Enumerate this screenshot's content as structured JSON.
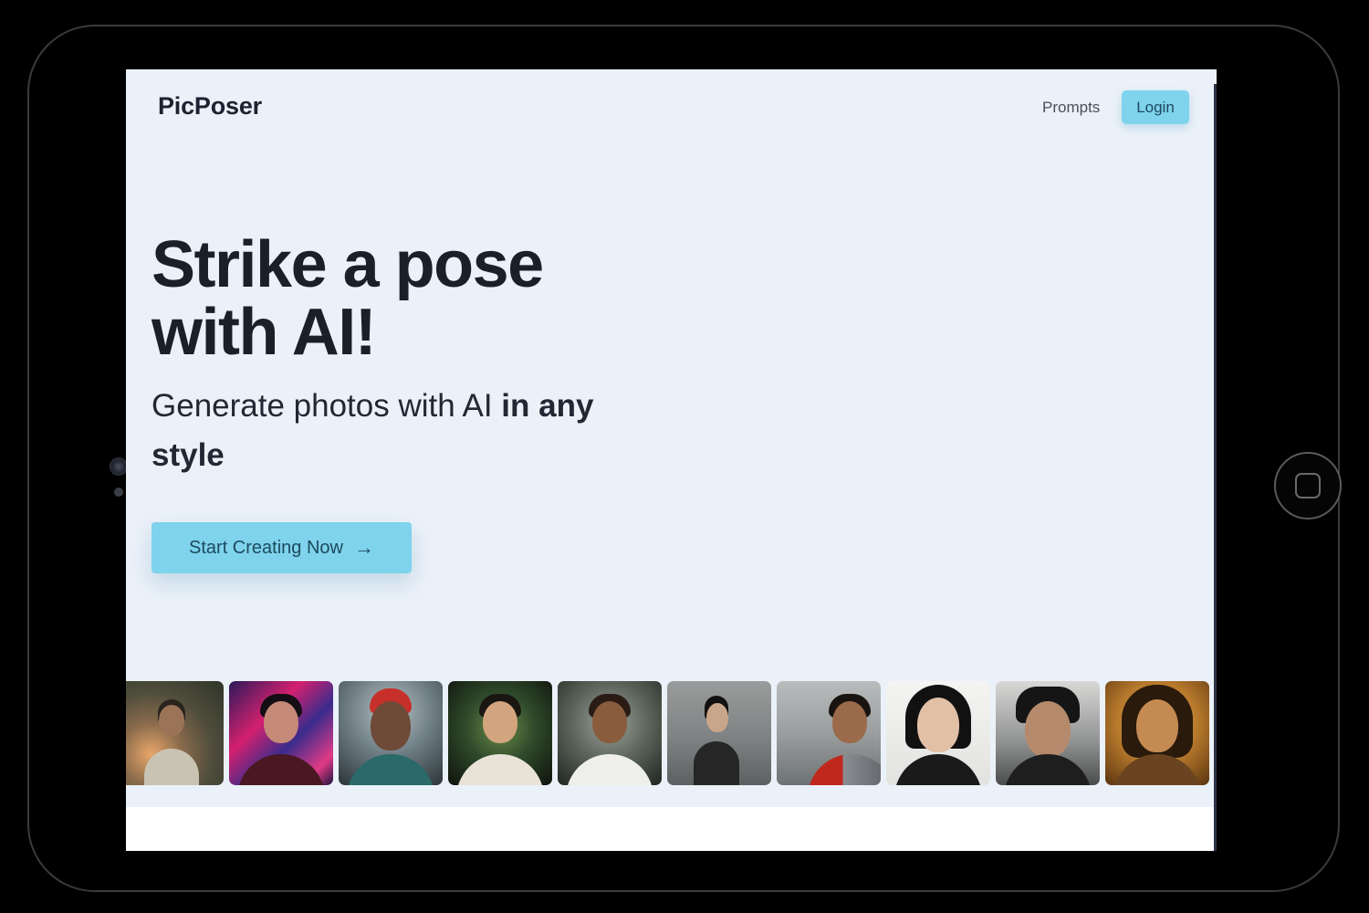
{
  "header": {
    "brand": "PicPoser",
    "nav_prompts": "Prompts",
    "login_label": "Login"
  },
  "hero": {
    "headline": "Strike a pose with AI!",
    "subhead_plain": "Generate photos with AI ",
    "subhead_bold": "in any style",
    "cta_label": "Start Creating Now",
    "cta_icon": "arrow-right-icon"
  },
  "gallery": {
    "items": [
      {
        "name": "portrait-forest-man"
      },
      {
        "name": "portrait-neon-woman"
      },
      {
        "name": "portrait-red-hair-man"
      },
      {
        "name": "portrait-astronaut-woman"
      },
      {
        "name": "portrait-astronaut-man"
      },
      {
        "name": "portrait-profile-woman"
      },
      {
        "name": "portrait-armor-man"
      },
      {
        "name": "portrait-woman-closeup"
      },
      {
        "name": "portrait-samurai-man"
      },
      {
        "name": "portrait-sepia-man"
      }
    ]
  },
  "colors": {
    "hero_bg": "#ebf1f9",
    "accent": "#7fd3ec",
    "accent_text": "#1c4a5e",
    "heading": "#1b1f29"
  }
}
